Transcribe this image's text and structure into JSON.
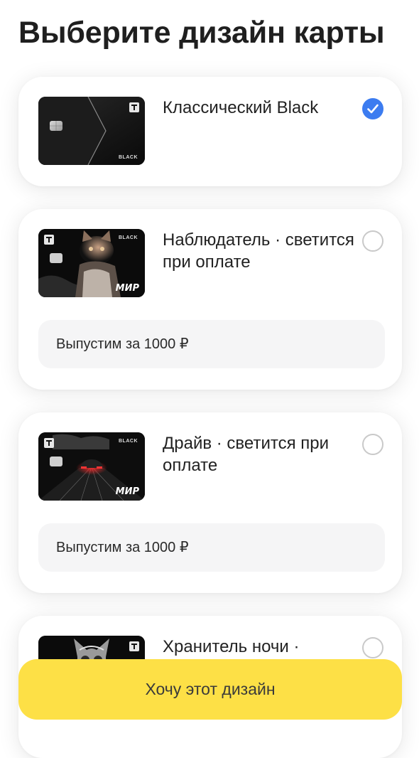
{
  "header": {
    "title": "Выберите дизайн карты"
  },
  "options": [
    {
      "label": "Классический Black",
      "selected": true,
      "design": "classic-black",
      "card_text": "BLACK"
    },
    {
      "label": "Наблюдатель · светится при оплате",
      "selected": false,
      "design": "cat",
      "card_text": "BLACK",
      "payment_logo": "МИР",
      "price": "Выпустим за 1000 ₽"
    },
    {
      "label": "Драйв · светится при оплате",
      "selected": false,
      "design": "car",
      "card_text": "BLACK",
      "payment_logo": "МИР",
      "price": "Выпустим за 1000 ₽"
    },
    {
      "label": "Хранитель ночи ·",
      "selected": false,
      "design": "owl"
    }
  ],
  "cta": {
    "label": "Хочу этот дизайн"
  },
  "colors": {
    "accent_yellow": "#fde046",
    "radio_selected": "#3c7cf0",
    "price_bg": "#f5f5f6"
  }
}
